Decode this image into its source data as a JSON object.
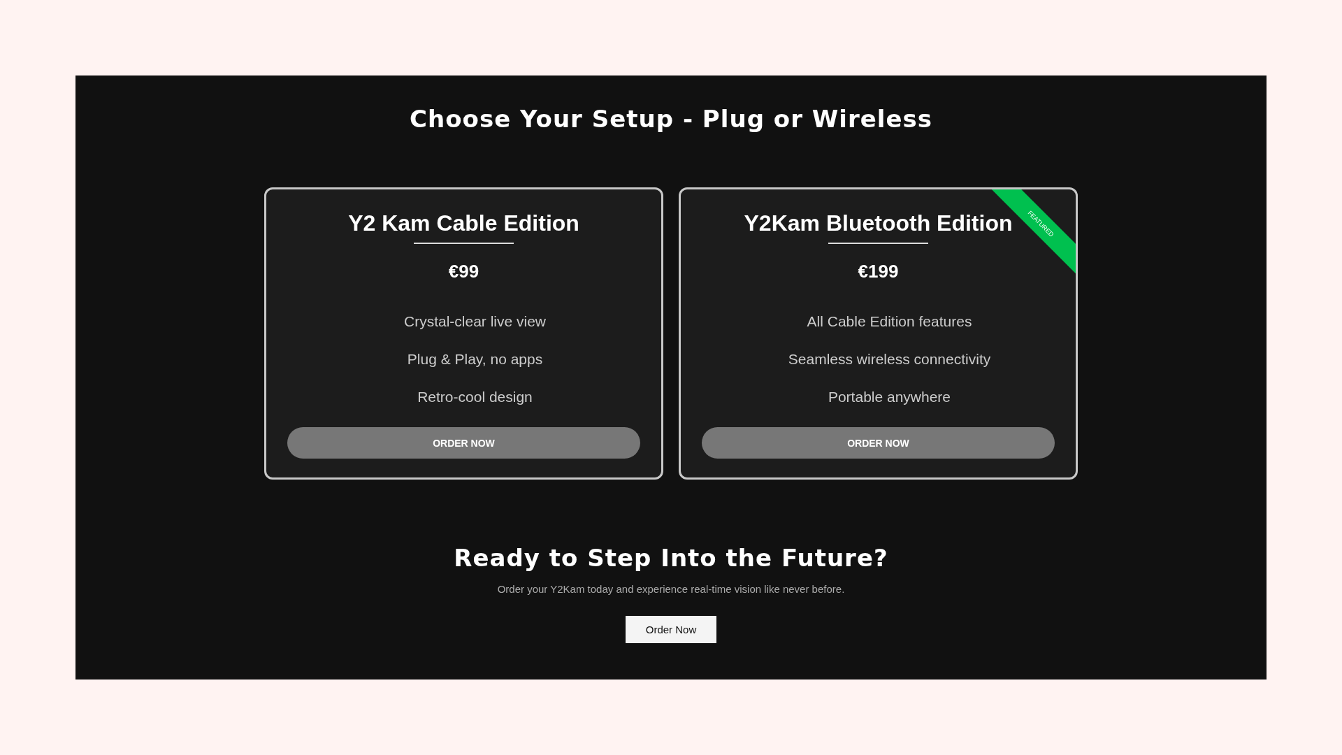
{
  "heading": "Choose Your Setup - Plug or Wireless",
  "plans": [
    {
      "name": "Y2 Kam Cable Edition",
      "price": "€99",
      "features": [
        "Crystal-clear live view",
        "Plug & Play, no apps",
        "Retro-cool design"
      ],
      "button": "ORDER NOW"
    },
    {
      "name": "Y2Kam Bluetooth Edition",
      "price": "€199",
      "ribbon": "FEATURED",
      "features": [
        "All Cable Edition features",
        "Seamless wireless connectivity",
        "Portable anywhere"
      ],
      "button": "ORDER NOW"
    }
  ],
  "cta": {
    "heading": "Ready to Step Into the Future?",
    "text": "Order your Y2Kam today and experience real-time vision like never before.",
    "button": "Order Now"
  }
}
